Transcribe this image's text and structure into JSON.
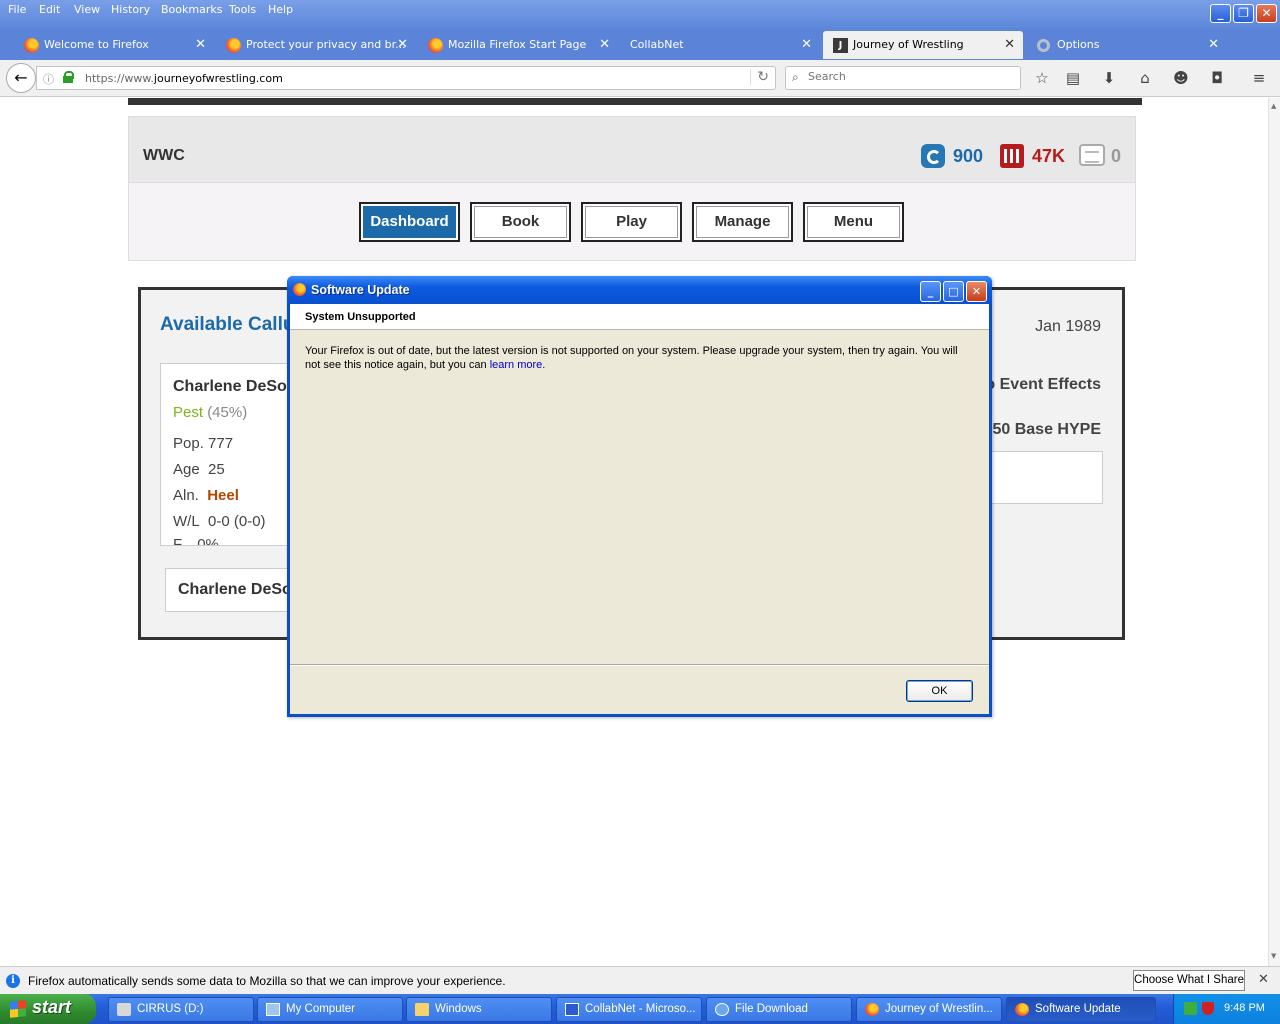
{
  "menubar": [
    "File",
    "Edit",
    "View",
    "History",
    "Bookmarks",
    "Tools",
    "Help"
  ],
  "tabs": [
    {
      "label": "Welcome to Firefox",
      "icon": "firefox-icon"
    },
    {
      "label": "Protect your privacy and br...",
      "icon": "firefox-icon"
    },
    {
      "label": "Mozilla Firefox Start Page",
      "icon": "firefox-icon"
    },
    {
      "label": "CollabNet",
      "icon": "none"
    },
    {
      "label": "Journey of Wrestling",
      "icon": "j-icon",
      "active": true
    },
    {
      "label": "Options",
      "icon": "gear-icon"
    }
  ],
  "address": {
    "prefix": "https://www.",
    "domain": "journeyofwrestling.com"
  },
  "search": {
    "placeholder": "Search"
  },
  "page": {
    "brand": "WWC",
    "stats": {
      "coins": "900",
      "hype": "47K",
      "messages": "0"
    },
    "nav": [
      "Dashboard",
      "Book",
      "Play",
      "Manage",
      "Menu"
    ],
    "card_title": "Available Callu",
    "date": "Jan 1989",
    "event_effects": "o Event Effects",
    "base_hype": "50 Base HYPE",
    "wrestler": {
      "name": "Charlene DeSo",
      "gimmick": "Pest",
      "gimmick_pct": "(45%)",
      "pop_label": "Pop.",
      "pop": "777",
      "age_label": "Age",
      "age": "25",
      "aln_label": "Aln.",
      "aln": "Heel",
      "wl_label": "W/L",
      "wl": "0-0 (0-0)",
      "cut_label": "F...",
      "cut": "0%"
    },
    "bottom_name": "Charlene DeSo"
  },
  "dialog": {
    "title": "Software Update",
    "heading": "System Unsupported",
    "body": "Your Firefox is out of date, but the latest version is not supported on your system. Please upgrade your system, then try again. You will not see this notice again, but you can",
    "link": "learn more.",
    "ok": "OK"
  },
  "notification": {
    "text": "Firefox automatically sends some data to Mozilla so that we can improve your experience.",
    "button": "Choose What I Share"
  },
  "taskbar": {
    "start": "start",
    "items": [
      {
        "label": "CIRRUS (D:)",
        "icon": "drive"
      },
      {
        "label": "My Computer",
        "icon": "comp"
      },
      {
        "label": "Windows",
        "icon": "folder"
      },
      {
        "label": "CollabNet - Microso...",
        "icon": "word"
      },
      {
        "label": "File Download",
        "icon": "dl"
      },
      {
        "label": "Journey of Wrestlin...",
        "icon": "ff"
      },
      {
        "label": "Software Update",
        "icon": "ff",
        "active": true
      }
    ],
    "clock": "9:48 PM"
  },
  "colors": {
    "accent": "#1c6aa9",
    "hype_red": "#b71c1c",
    "pest_green": "#7cb518",
    "heel": "#b34700",
    "xp_blue": "#0a4fc8"
  }
}
